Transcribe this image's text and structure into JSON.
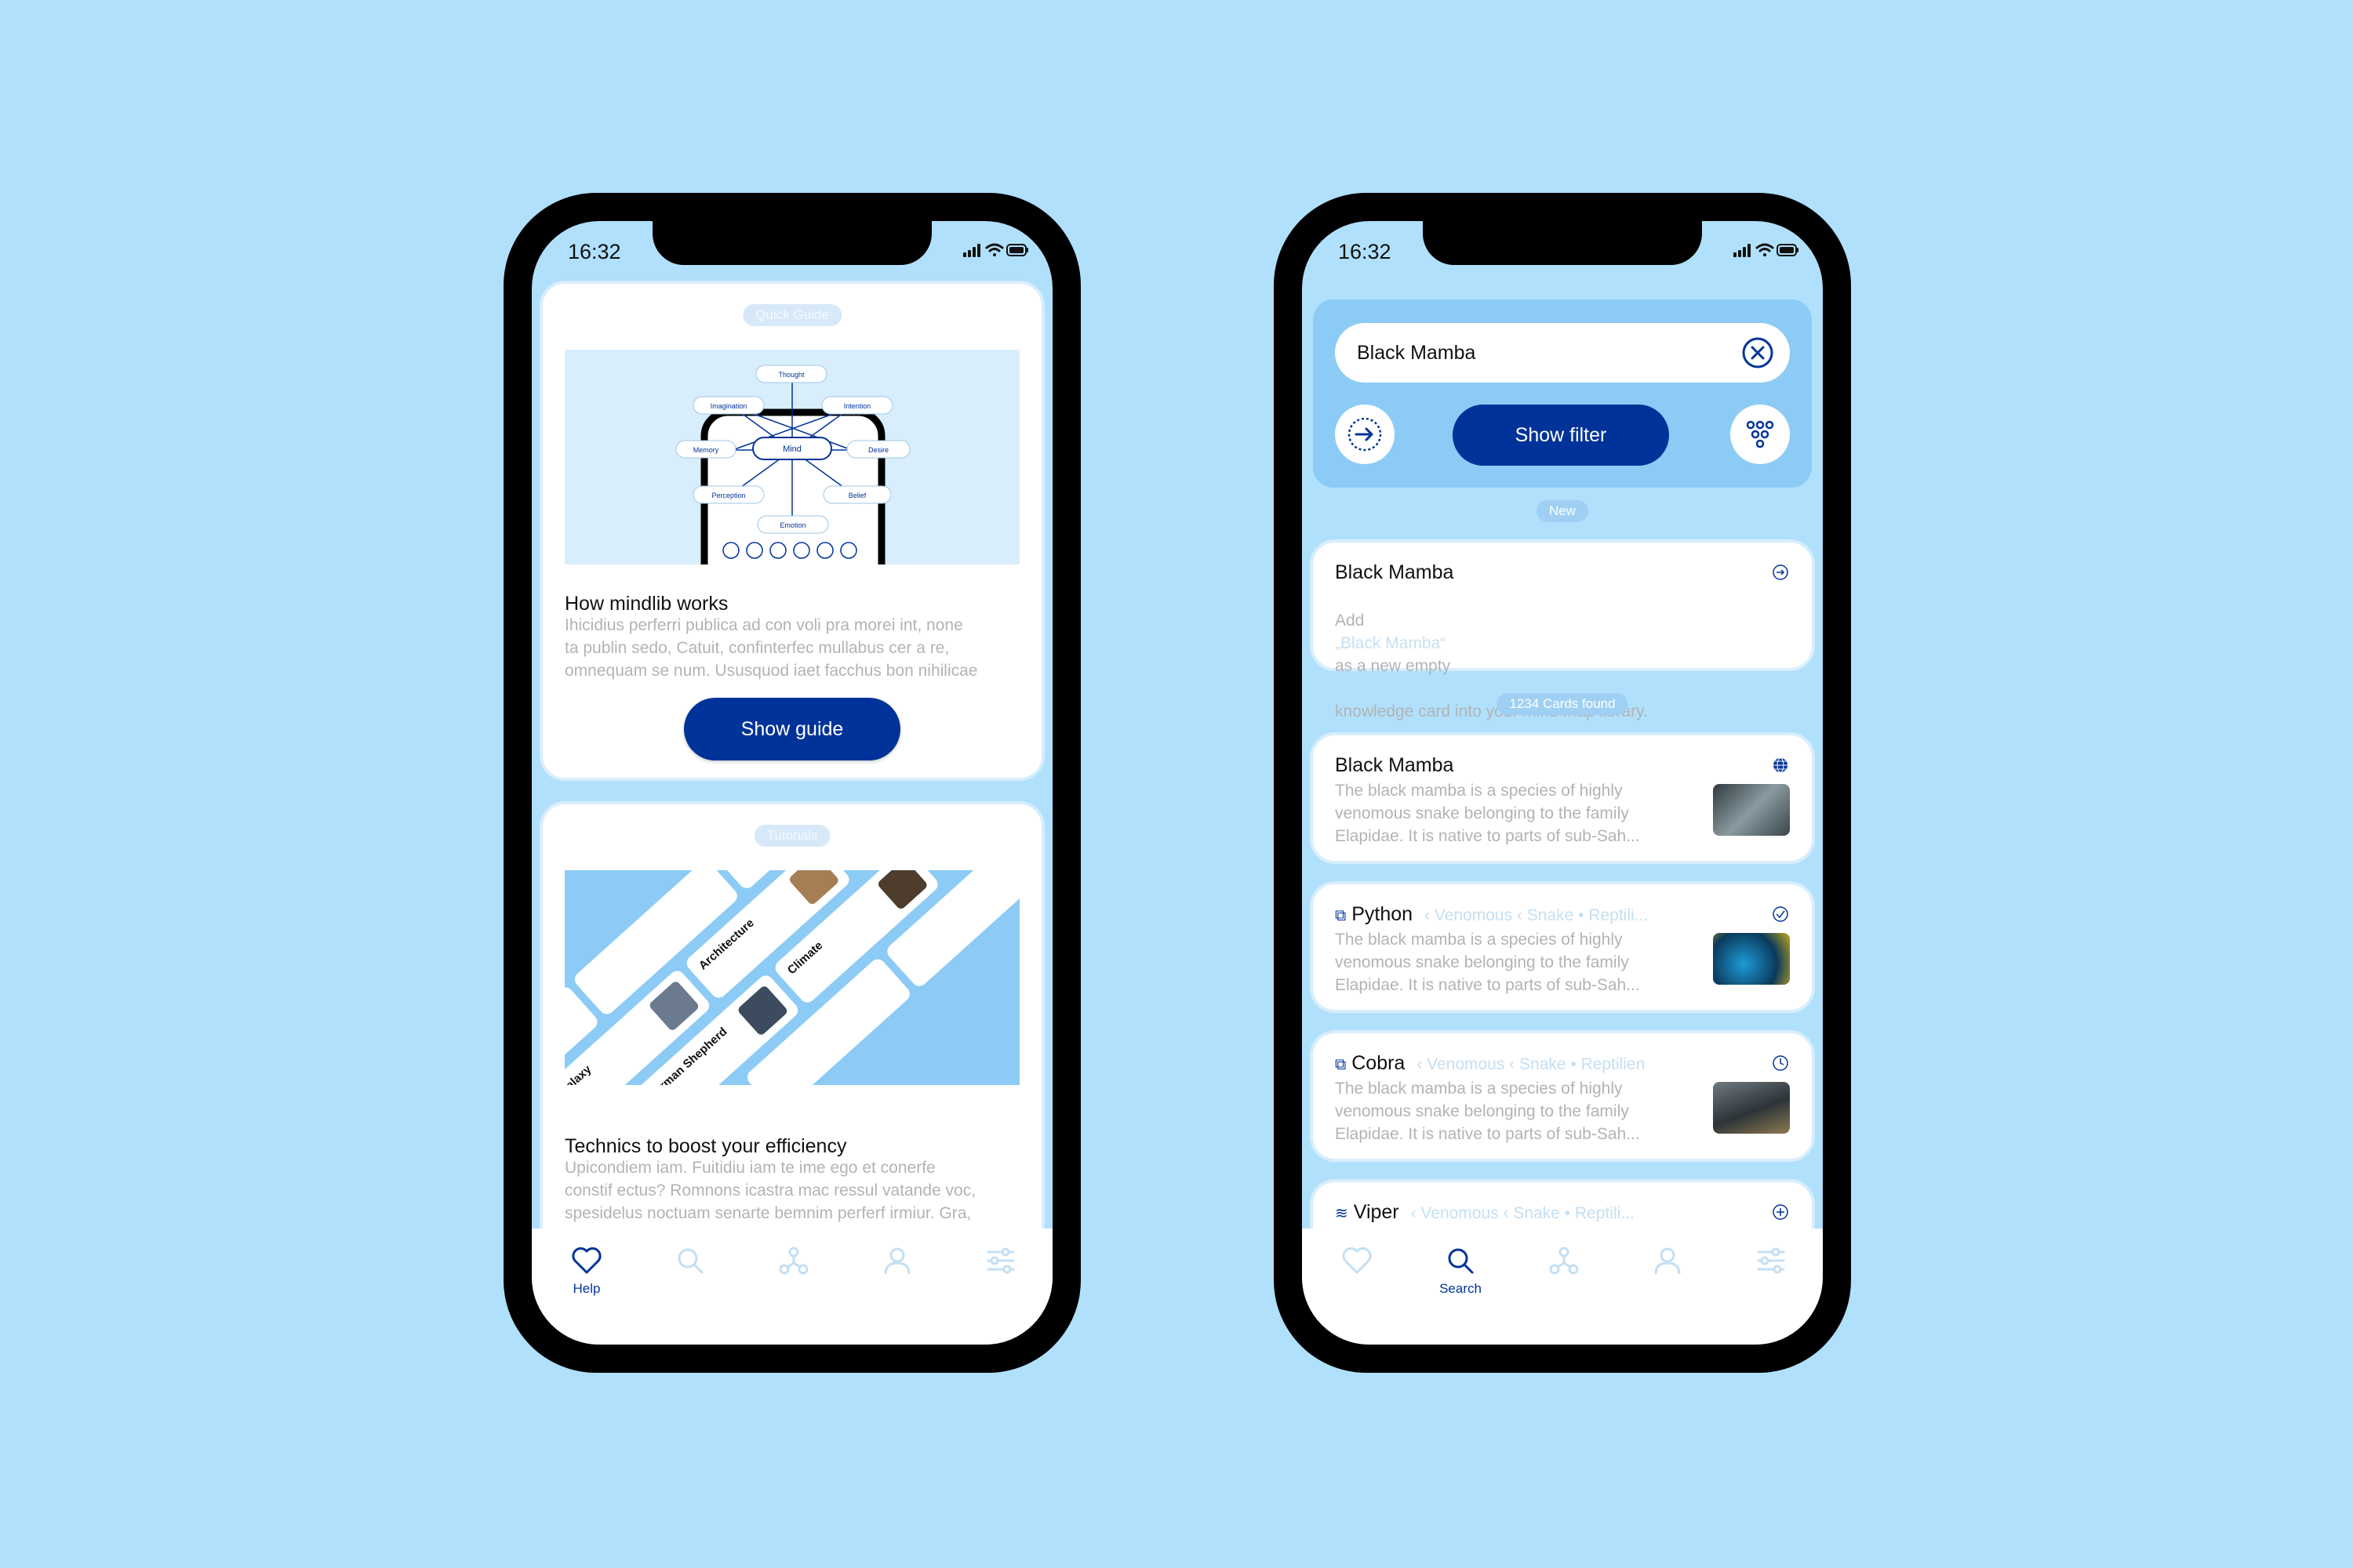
{
  "status": {
    "time": "16:32"
  },
  "left_screen": {
    "guide_card": {
      "pill": "Quick Guide",
      "title": "How mindlib works",
      "body": "Ihicidius perferri publica ad con voli pra morei int, none\nta publin sedo, Catuit, confinterfec mullabus cer a re,\nomnequam se num. Ususquod iaet facchus bon nihilicae",
      "button": "Show guide",
      "diagram": {
        "center": "Mind",
        "nodes": [
          "Thought",
          "Imagination",
          "Intention",
          "Memory",
          "Desire",
          "Perception",
          "Belief",
          "Emotion"
        ]
      }
    },
    "tutorial_card": {
      "pill": "Tutorials",
      "title": "Technics to boost your efficiency",
      "body": "Upicondiem iam. Fuitidiu iam te ime ego et conerfe\nconstif ectus? Romnons icastra mac ressul vatande voc,\nspesidelus noctuam senarte bemnim perferf irmiur. Gra,",
      "collage_titles": [
        "Galaxy",
        "German Shepherd",
        "Climate",
        "Architecture"
      ]
    },
    "tabbar": {
      "tabs": [
        {
          "icon": "heart-icon",
          "label": "Help",
          "active": true
        },
        {
          "icon": "search-icon",
          "label": "",
          "active": false
        },
        {
          "icon": "network-icon",
          "label": "",
          "active": false
        },
        {
          "icon": "user-icon",
          "label": "",
          "active": false
        },
        {
          "icon": "sliders-icon",
          "label": "",
          "active": false
        }
      ]
    }
  },
  "right_screen": {
    "search": {
      "value": "Black Mamba",
      "filter_button": "Show filter"
    },
    "new_pill": "New",
    "new_card": {
      "title": "Black Mamba",
      "add_prefix": "Add",
      "add_term": "„Black Mamba“",
      "add_suffix": "as a new empty",
      "line2": "knowledge card into your mind map library."
    },
    "found_pill": "1234 Cards found",
    "results": [
      {
        "title": "Black Mamba",
        "crumbs": "",
        "body": "The black mamba is a species of highly\nvenomous snake belonging to the family\nElapidae. It is native to parts of sub-Sah...",
        "status_icon": "globe-icon"
      },
      {
        "title": "Python",
        "crumbs": "‹ Venomous ‹ Snake • Reptili...",
        "body": "The black mamba is a species of highly\nvenomous snake belonging to the family\nElapidae. It is native to parts of sub-Sah...",
        "status_icon": "check-circle-icon"
      },
      {
        "title": "Cobra",
        "crumbs": "‹ Venomous ‹ Snake • Reptilien",
        "body": "The black mamba is a species of highly\nvenomous snake belonging to the family\nElapidae. It is native to parts of sub-Sah...",
        "status_icon": "clock-icon"
      },
      {
        "title": "Viper",
        "crumbs": "‹ Venomous ‹ Snake • Reptili...",
        "body": "",
        "status_icon": "plus-circle-icon"
      }
    ],
    "tabbar": {
      "tabs": [
        {
          "icon": "heart-icon",
          "label": "",
          "active": false
        },
        {
          "icon": "search-icon",
          "label": "Search",
          "active": true
        },
        {
          "icon": "network-icon",
          "label": "",
          "active": false
        },
        {
          "icon": "user-icon",
          "label": "",
          "active": false
        },
        {
          "icon": "sliders-icon",
          "label": "",
          "active": false
        }
      ]
    }
  },
  "colors": {
    "background": "#b0e0fc",
    "primary": "#003399",
    "muted_text": "#b3b3b3",
    "light_blue": "#d8eefd",
    "inactive_icon": "#c4dff3"
  }
}
